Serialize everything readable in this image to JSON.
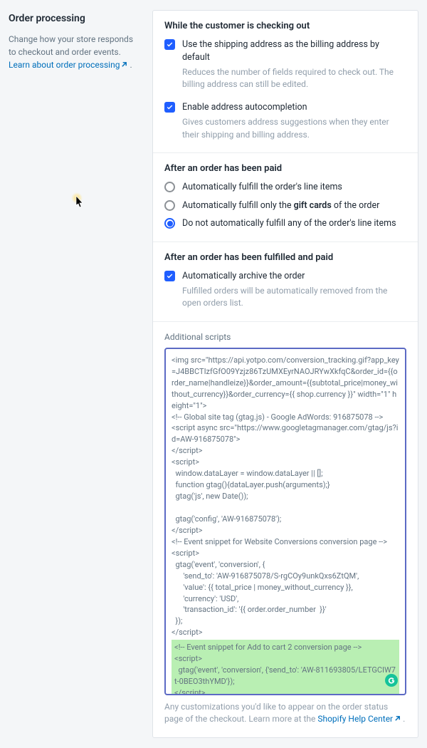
{
  "left": {
    "title": "Order processing",
    "desc_a": "Change how your store responds to checkout and order events. ",
    "link_text": "Learn about order processing"
  },
  "checkout": {
    "title": "While the customer is checking out",
    "opt1_label": "Use the shipping address as the billing address by default",
    "opt1_help": "Reduces the number of fields required to check out. The billing address can still be edited.",
    "opt2_label": "Enable address autocompletion",
    "opt2_help": "Gives customers address suggestions when they enter their shipping and billing address."
  },
  "paid": {
    "title": "After an order has been paid",
    "r1": "Automatically fulfill the order's line items",
    "r2_a": "Automatically fulfill only the ",
    "r2_b": "gift cards",
    "r2_c": " of the order",
    "r3": "Do not automatically fulfill any of the order's line items"
  },
  "fulfilled": {
    "title": "After an order has been fulfilled and paid",
    "c1_label": "Automatically archive the order",
    "c1_help": "Fulfilled orders will be automatically removed from the open orders list."
  },
  "scripts": {
    "label": "Additional scripts",
    "body_pre": "<img src=\"https://api.yotpo.com/conversion_tracking.gif?app_key=J4BBCTIzfGfO09Yzjz86TzUMXEyrNAOJRYwXkfqC&order_id={{order_name|handleize}}&order_amount={{subtotal_price|money_without_currency}}&order_currency={{ shop.currency }}\" width=\"1\" height=\"1\">\n<!-- Global site tag (gtag.js) - Google AdWords: 916875078 -->\n<script async src=\"https://www.googletagmanager.com/gtag/js?id=AW-916875078\">\n</script>\n<script>\n  window.dataLayer = window.dataLayer || [];\n  function gtag(){dataLayer.push(arguments);}\n  gtag('js', new Date());\n\n  gtag('config', 'AW-916875078');\n</script>\n<!-- Event snippet for Website Conversions conversion page -->\n<script>\n  gtag('event', 'conversion', {\n      'send_to': 'AW-916875078/S-rgCOy9unkQxs6ZtQM',\n      'value': {{ total_price | money_without_currency }},\n      'currency': 'USD',\n      'transaction_id': '{{ order.order_number  }}'\n  });\n</script>",
    "body_hl": "<!-- Event snippet for Add to cart 2 conversion page -->\n<script>\n  gtag('event', 'conversion', {'send_to': 'AW-811693805/LETGCIW7t-0BEO3thYMD'});\n</script>",
    "footnote_a": "Any customizations you'd like to appear on the order status page of the checkout. Learn more at the ",
    "footnote_link": "Shopify Help Center"
  }
}
